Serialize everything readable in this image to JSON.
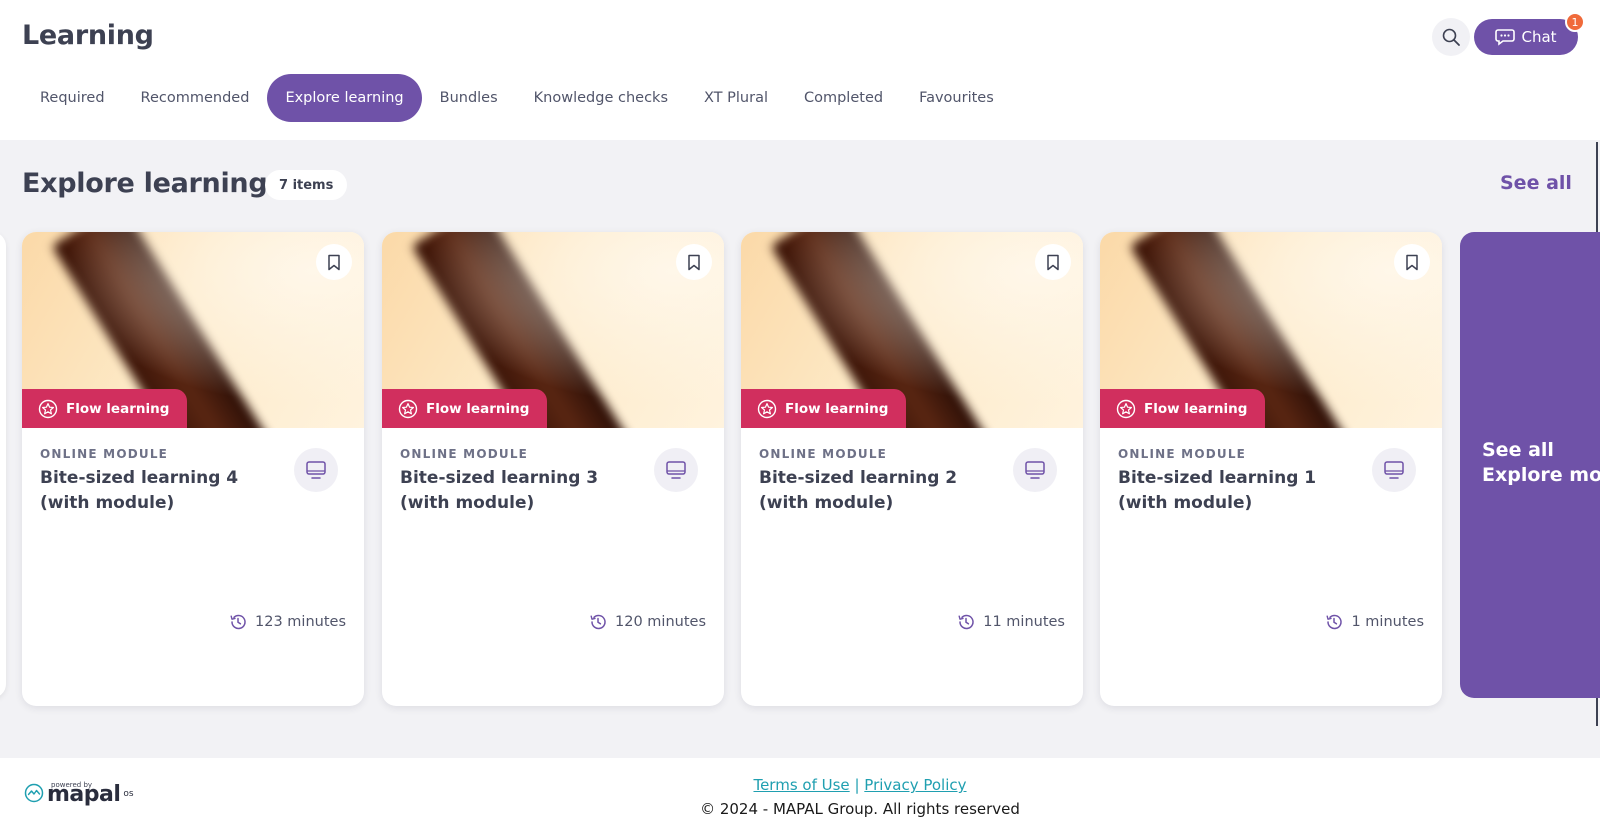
{
  "header": {
    "title": "Learning",
    "chat_label": "Chat",
    "chat_badge": "1"
  },
  "tabs": [
    {
      "label": "Required"
    },
    {
      "label": "Recommended"
    },
    {
      "label": "Explore learning",
      "active": true
    },
    {
      "label": "Bundles"
    },
    {
      "label": "Knowledge checks"
    },
    {
      "label": "XT Plural"
    },
    {
      "label": "Completed"
    },
    {
      "label": "Favourites"
    }
  ],
  "section": {
    "title": "Explore learning",
    "count": "7 items",
    "see_all": "See all"
  },
  "cards": [
    {
      "badge": "Flow learning",
      "type": "ONLINE MODULE",
      "title": "Bite-sized learning 4 (with module)",
      "duration": "123 minutes"
    },
    {
      "badge": "Flow learning",
      "type": "ONLINE MODULE",
      "title": "Bite-sized learning 3 (with module)",
      "duration": "120 minutes"
    },
    {
      "badge": "Flow learning",
      "type": "ONLINE MODULE",
      "title": "Bite-sized learning 2 (with module)",
      "duration": "11 minutes"
    },
    {
      "badge": "Flow learning",
      "type": "ONLINE MODULE",
      "title": "Bite-sized learning 1 (with module)",
      "duration": "1 minutes"
    }
  ],
  "see_all_card": {
    "line1": "See all",
    "line2": "Explore mo"
  },
  "footer": {
    "terms": "Terms of Use",
    "separator": "|",
    "privacy": "Privacy Policy",
    "copyright": "© 2024 - MAPAL Group. All rights reserved",
    "logo_powered": "powered by",
    "logo_name": "mapal",
    "logo_suffix": "os"
  },
  "colors": {
    "accent": "#6f52a8",
    "badge": "#d12f5e",
    "notification": "#f06a3a",
    "link": "#1f9fb0"
  },
  "icons": {
    "search": "search-icon",
    "chat": "chat-bubble-icon",
    "bookmark": "bookmark-icon",
    "flow": "star-badge-icon",
    "module": "monitor-icon",
    "duration": "clock-history-icon"
  }
}
